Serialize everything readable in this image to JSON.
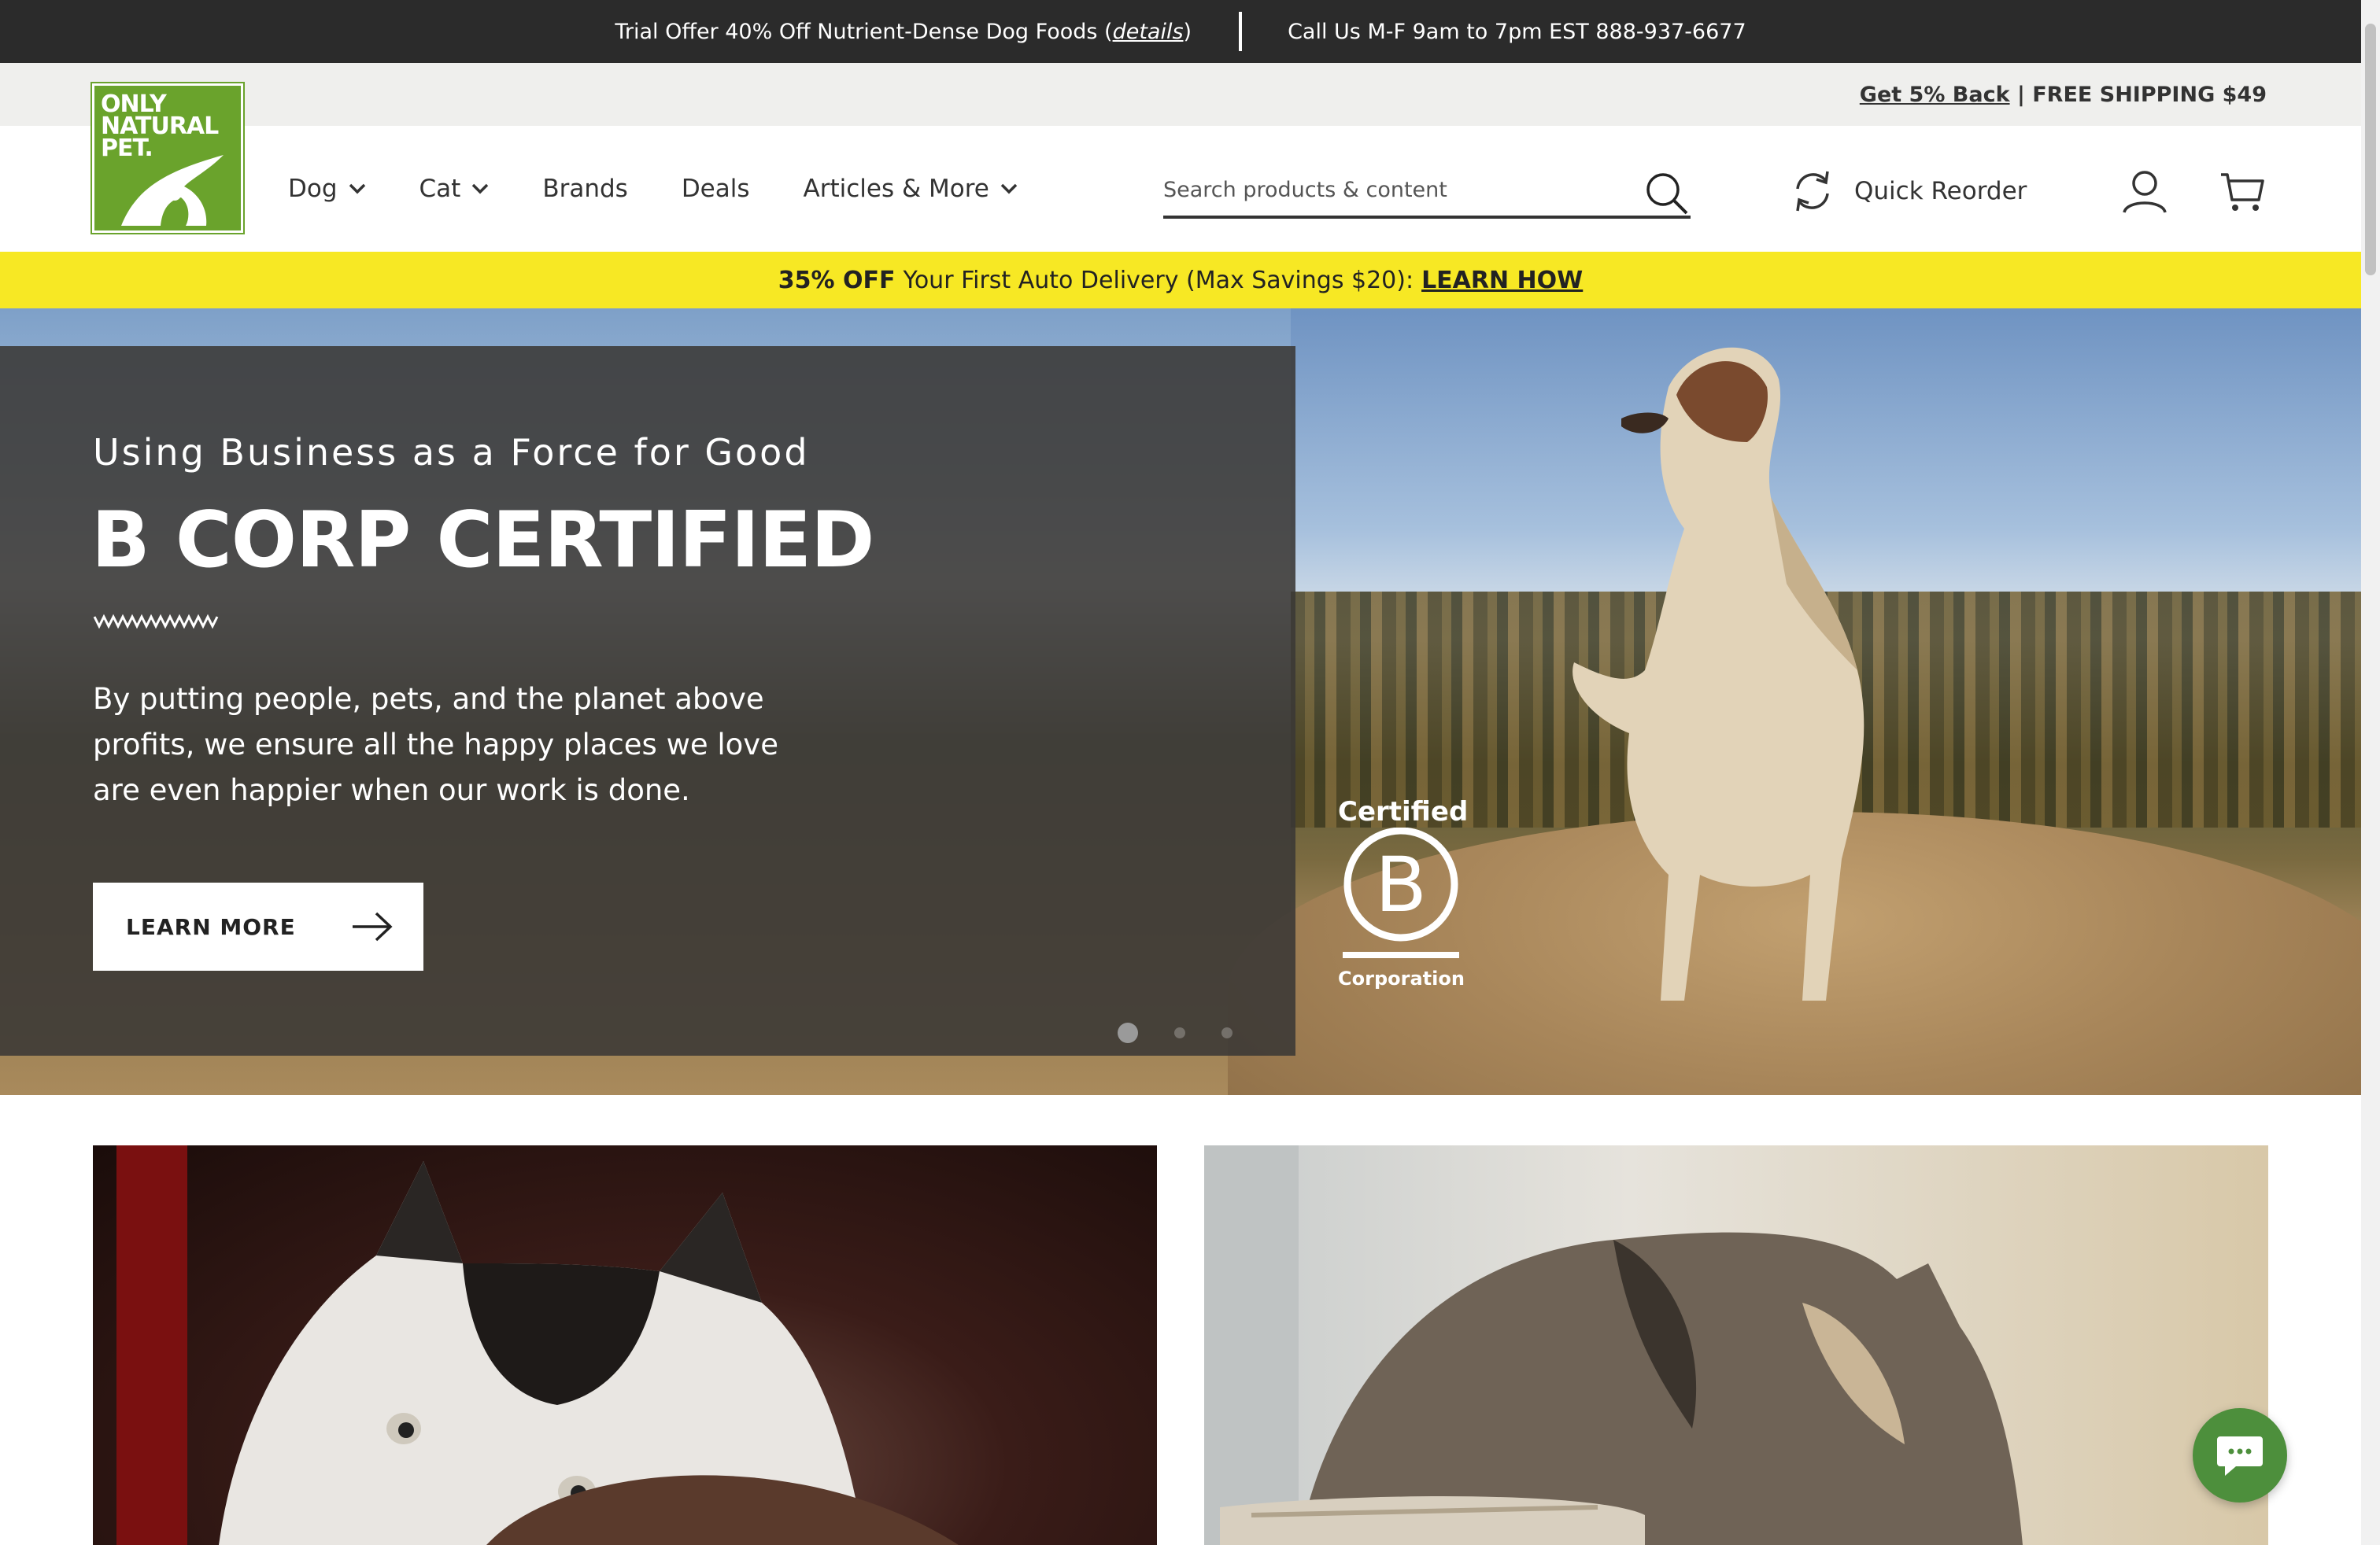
{
  "topbar": {
    "offer_prefix": "Trial Offer 40% Off Nutrient-Dense Dog Foods (",
    "offer_link": "details",
    "offer_suffix": ")",
    "phone": "Call Us M-F 9am to 7pm EST 888-937-6677"
  },
  "utility": {
    "cashback": "Get 5% Back",
    "separator": " | ",
    "shipping": "FREE SHIPPING $49"
  },
  "logo": {
    "line1": "ONLY",
    "line2": "NATURAL",
    "line3": "PET."
  },
  "nav": {
    "dog": "Dog",
    "cat": "Cat",
    "brands": "Brands",
    "deals": "Deals",
    "articles": "Articles & More"
  },
  "search": {
    "placeholder": "Search products & content"
  },
  "header": {
    "quick_reorder": "Quick Reorder"
  },
  "promo": {
    "bold": "35% OFF",
    "text": "Your First Auto Delivery (Max Savings $20):",
    "link": "LEARN HOW"
  },
  "hero": {
    "eyebrow": "Using Business as a Force for Good",
    "headline": "B CORP CERTIFIED",
    "body": "By putting people, pets, and the planet above profits, we ensure all the happy places we love are even happier when our work is done.",
    "cta": "LEARN MORE",
    "badge_top": "Certified",
    "badge_letter": "B",
    "badge_bottom": "Corporation",
    "slide_count": 3,
    "active_slide": 1
  },
  "colors": {
    "brand_green": "#6aa32c",
    "promo_yellow": "#f7e824",
    "topbar_dark": "#2b2b2b",
    "chat_green": "#4d8f3c"
  }
}
